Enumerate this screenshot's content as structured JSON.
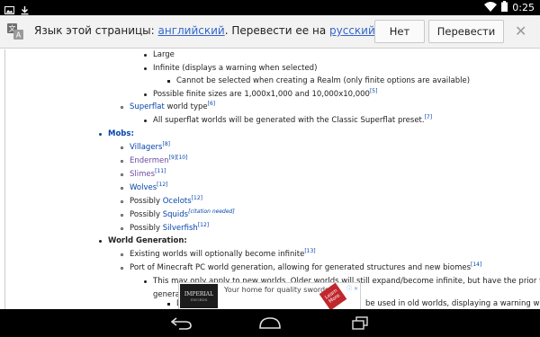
{
  "status": {
    "time": "0:25",
    "notification_icons": [
      "image-icon",
      "download-icon"
    ],
    "system_icons": [
      "wifi-icon",
      "battery-icon"
    ]
  },
  "translate_bar": {
    "prefix": "Язык этой страницы: ",
    "source_lang": "английский",
    "middle": ". Перевести ее на ",
    "target_lang": "русский",
    "suffix": "?",
    "no_label": "Нет",
    "yes_label": "Перевести",
    "close_glyph": "✕"
  },
  "content": {
    "large": "Large",
    "infinite": "Infinite (displays a warning when selected)",
    "realm_note": "Cannot be selected when creating a Realm (only finite options are available)",
    "finite_sizes": "Possible finite sizes are 1,000x1,000 and 10,000x10,000",
    "finite_sizes_ref": "[5]",
    "superflat_link": "Superflat",
    "superflat_rest": " world type",
    "superflat_ref": "[6]",
    "superflat_note": "All superflat worlds will be generated with the Classic Superflat preset.",
    "superflat_note_ref": "[7]",
    "mobs_heading": "Mobs:",
    "villagers": "Villagers",
    "villagers_ref": "[8]",
    "endermen": "Endermen",
    "endermen_ref": "[9][10]",
    "slimes": "Slimes",
    "slimes_ref": "[11]",
    "wolves": "Wolves",
    "wolves_ref": "[12]",
    "possibly": "Possibly ",
    "ocelots": "Ocelots",
    "ocelots_ref": "[12]",
    "squids": "Squids",
    "squids_ref": "[citation needed]",
    "silverfish": "Silverfish",
    "silverfish_ref": "[12]",
    "worldgen_heading": "World Generation:",
    "existing_worlds": "Existing worlds will optionally become infinite",
    "existing_worlds_ref": "[13]",
    "port_pc": "Port of Minecraft PC world generation, allowing for generated structures and new biomes",
    "port_pc_ref": "[14]",
    "new_worlds": "This may only apply to new worlds. Older worlds will still expand/become infinite, but have the prior terrain",
    "generation_partial": "generati",
    "d_partial": "D",
    "used_partial": "be used in old worlds, displaying a warning when"
  },
  "ad": {
    "brand": "IMPERIAL",
    "brand_sub": "SWORDS",
    "tagline": "Your home for quality swords!",
    "cta": "Learn More",
    "info": "ⓘ ✕"
  },
  "nav": {
    "icons": [
      "back-icon",
      "home-icon",
      "recents-icon"
    ]
  }
}
